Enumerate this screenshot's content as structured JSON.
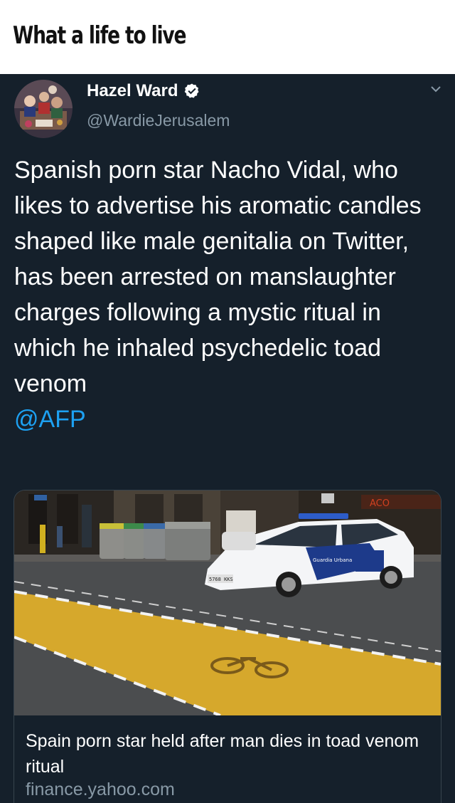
{
  "meme": {
    "caption": "What a life to live"
  },
  "tweet": {
    "author": {
      "display_name": "Hazel Ward",
      "handle": "@WardieJerusalem",
      "verified": true
    },
    "text": "Spanish porn star Nacho Vidal, who likes to advertise his aromatic candles shaped like male genitalia on Twitter, has been arrested on manslaughter charges following a mystic ritual in which he inhaled psychedelic toad venom",
    "mention": "@AFP",
    "menu_icon": "chevron-down-icon",
    "colors": {
      "background": "#15202b",
      "secondary_text": "#8899a6",
      "link": "#1da1f2",
      "verified_badge": "#ffffff"
    }
  },
  "link_card": {
    "title": "Spain porn star held after man dies in toad venom ritual",
    "domain": "finance.yahoo.com",
    "image": {
      "vehicle_text": "Guardia Urbana",
      "plate_text": "5768 KKS",
      "shop_sign": "ACO"
    }
  }
}
